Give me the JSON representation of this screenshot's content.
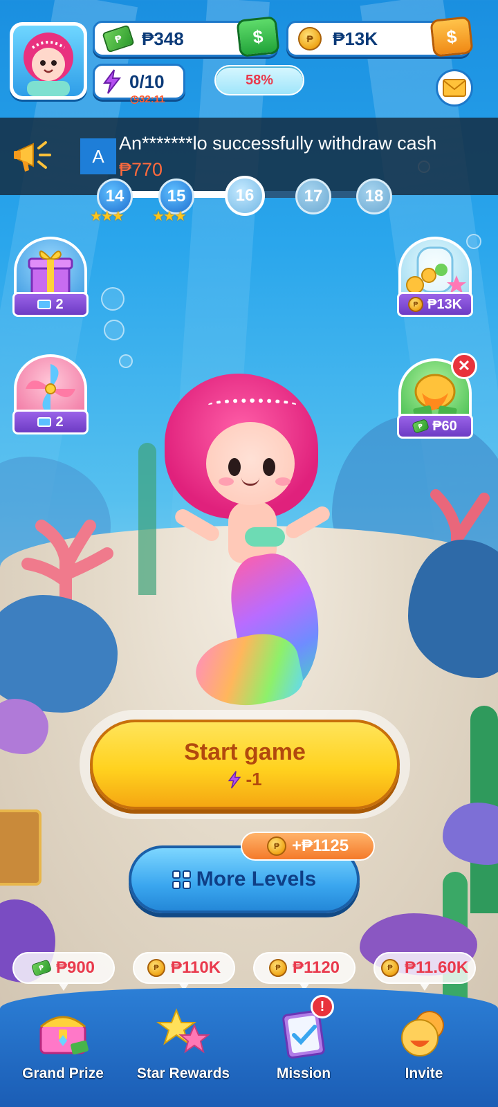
{
  "colors": {
    "accent_red": "#e93a4d",
    "gold": "#ffd21f",
    "blue": "#1d78c9",
    "purple": "#7a45d1"
  },
  "header": {
    "avatar_icon": "mermaid-avatar",
    "cash": {
      "icon": "cash-icon",
      "value": "₱348",
      "button_icon": "dollar-cash-icon",
      "button_label": "$"
    },
    "coins": {
      "icon": "coin-icon",
      "value": "₱13K",
      "button_icon": "dollar-coin-icon",
      "button_label": "$"
    },
    "energy": {
      "icon": "bolt-icon",
      "value": "0/10",
      "timer": "32:11",
      "timer_icon": "clock-icon"
    },
    "progress": {
      "label": "58%",
      "value": 0.58
    },
    "mail_icon": "envelope-icon"
  },
  "ticker": {
    "icon": "megaphone-icon",
    "avatar_letter": "A",
    "message": "An*******lo successfully withdraw cash",
    "amount": "₱770"
  },
  "levels": [
    {
      "number": "14",
      "state": "done",
      "stars": "★★★"
    },
    {
      "number": "15",
      "state": "done",
      "stars": "★★★"
    },
    {
      "number": "16",
      "state": "current",
      "stars": ""
    },
    {
      "number": "17",
      "state": "locked",
      "stars": ""
    },
    {
      "number": "18",
      "state": "locked",
      "stars": ""
    }
  ],
  "side_left": [
    {
      "icon": "gift-box-icon",
      "count": "2",
      "tag_icon": "ticket-icon"
    },
    {
      "icon": "pinwheel-icon",
      "count": "2",
      "tag_icon": "ticket-icon"
    }
  ],
  "side_right": [
    {
      "icon": "treasure-jar-icon",
      "value": "₱13K",
      "tag_icon": "coin-icon"
    },
    {
      "icon": "cash-chest-icon",
      "value": "₱60",
      "tag_icon": "cash-icon",
      "close_icon": "close-icon"
    }
  ],
  "main": {
    "start_label": "Start game",
    "start_cost": "-1",
    "start_cost_icon": "bolt-icon",
    "more_levels_label": "More Levels",
    "more_levels_icon": "grid-icon",
    "bonus": "+₱1125",
    "bonus_icon": "coin-icon"
  },
  "rewards": [
    {
      "icon": "cash-icon",
      "value": "₱900"
    },
    {
      "icon": "coin-icon",
      "value": "₱110K"
    },
    {
      "icon": "coin-icon",
      "value": "₱1120"
    },
    {
      "icon": "coin-icon",
      "value": "₱11.60K"
    }
  ],
  "nav": [
    {
      "label": "Grand Prize",
      "icon": "treasure-chest-icon"
    },
    {
      "label": "Star Rewards",
      "icon": "stars-icon"
    },
    {
      "label": "Mission",
      "icon": "clipboard-icon",
      "badge": "!"
    },
    {
      "label": "Invite",
      "icon": "invite-face-icon"
    }
  ]
}
